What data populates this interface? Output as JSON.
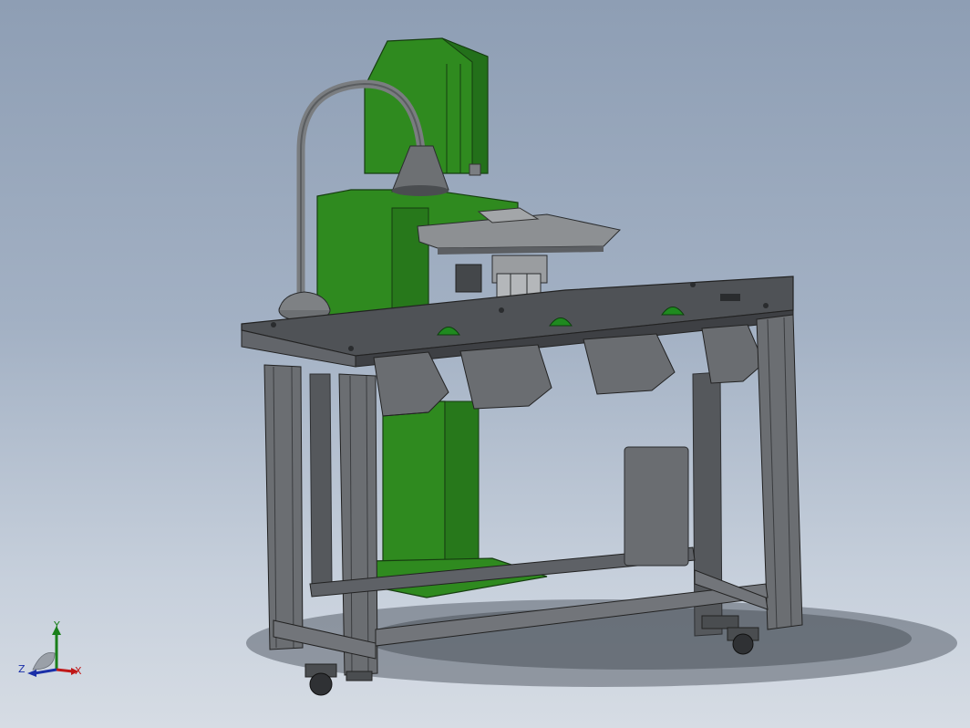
{
  "viewport": {
    "background_top": "#8e9eb4",
    "background_bottom": "#d6dce4"
  },
  "model": {
    "machine_color": "#2f8a1f",
    "frame_color": "#6b6e72",
    "panel_color": "#5c5f63",
    "button_color": "#1f8a1f"
  },
  "triad": {
    "x_label": "X",
    "y_label": "Y",
    "z_label": "Z",
    "x_color": "#c01818",
    "y_color": "#1a7f1a",
    "z_color": "#1a2fa8"
  }
}
